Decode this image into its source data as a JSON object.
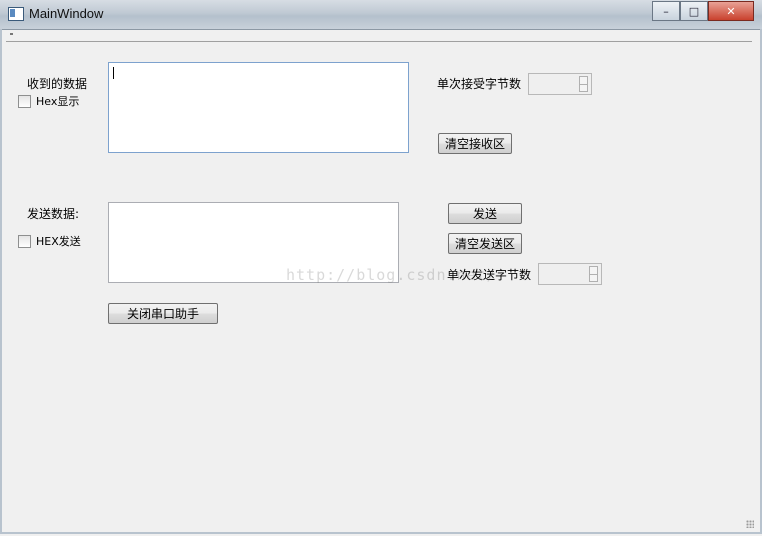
{
  "window": {
    "title": "MainWindow"
  },
  "receive": {
    "label": "收到的数据",
    "hex_checkbox": "Hex显示",
    "bytes_label": "单次接受字节数",
    "clear_button": "清空接收区"
  },
  "send": {
    "label": "发送数据:",
    "hex_checkbox": "HEX发送",
    "send_button": "发送",
    "clear_button": "清空发送区",
    "bytes_label": "单次发送字节数"
  },
  "close_button": "关闭串口助手",
  "watermark": "http://blog.csdn.net/"
}
